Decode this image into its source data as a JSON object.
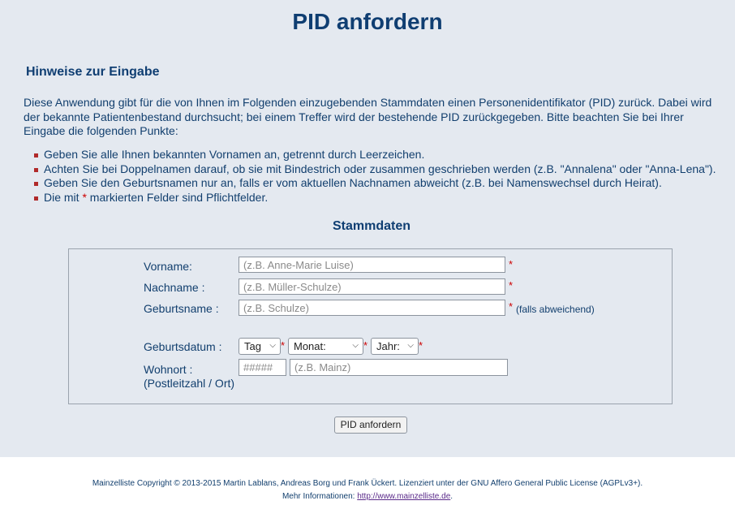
{
  "header": {
    "title": "PID anfordern"
  },
  "hints": {
    "heading": "Hinweise zur Eingabe",
    "intro": "Diese Anwendung gibt für die von Ihnen im Folgenden einzugebenden Stammdaten einen Personenidentifikator (PID) zurück. Dabei wird der bekannte Patientenbestand durchsucht; bei einem Treffer wird der bestehende PID zurückgegeben. Bitte beachten Sie bei Ihrer Eingabe die folgenden Punkte:",
    "items": [
      "Geben Sie alle Ihnen bekannten Vornamen an, getrennt durch Leerzeichen.",
      "Achten Sie bei Doppelnamen darauf, ob sie mit Bindestrich oder zusammen geschrieben werden (z.B. \"Annalena\" oder \"Anna-Lena\").",
      "Geben Sie den Geburtsnamen nur an, falls er vom aktuellen Nachnamen abweicht (z.B. bei Namenswechsel durch Heirat)."
    ],
    "last_item_prefix": "Die mit",
    "last_item_star": "*",
    "last_item_suffix": "markierten Felder sind Pflichtfelder."
  },
  "form": {
    "section_title": "Stammdaten",
    "required_mark": "*",
    "vorname": {
      "label": "Vorname:",
      "placeholder": "(z.B. Anne-Marie Luise)",
      "value": ""
    },
    "nachname": {
      "label": "Nachname :",
      "placeholder": "(z.B. Müller-Schulze)",
      "value": ""
    },
    "geburtsname": {
      "label": "Geburtsname :",
      "placeholder": "(z.B. Schulze)",
      "value": "",
      "note": "(falls abweichend)"
    },
    "geburtsdatum": {
      "label": "Geburtsdatum :",
      "day": "Tag",
      "month": "Monat:",
      "year": "Jahr:"
    },
    "wohnort": {
      "label": "Wohnort :",
      "sublabel": "(Postleitzahl / Ort)",
      "plz_placeholder": "#####",
      "ort_placeholder": "(z.B. Mainz)"
    },
    "submit_label": "PID anfordern"
  },
  "footer": {
    "line1": "Mainzelliste Copyright © 2013-2015 Martin Lablans, Andreas Borg und Frank Ückert. Lizenziert unter der GNU Affero General Public License (AGPLv3+).",
    "line2_prefix": "Mehr Informationen:",
    "link": "http://www.mainzelliste.de",
    "line2_suffix": "."
  },
  "colors": {
    "background": "#e4e9f0",
    "title": "#0f3e72",
    "required": "#cc0000",
    "bullet": "#b02a2a"
  },
  "icons": {
    "dropdown": "chevron-down-icon"
  }
}
